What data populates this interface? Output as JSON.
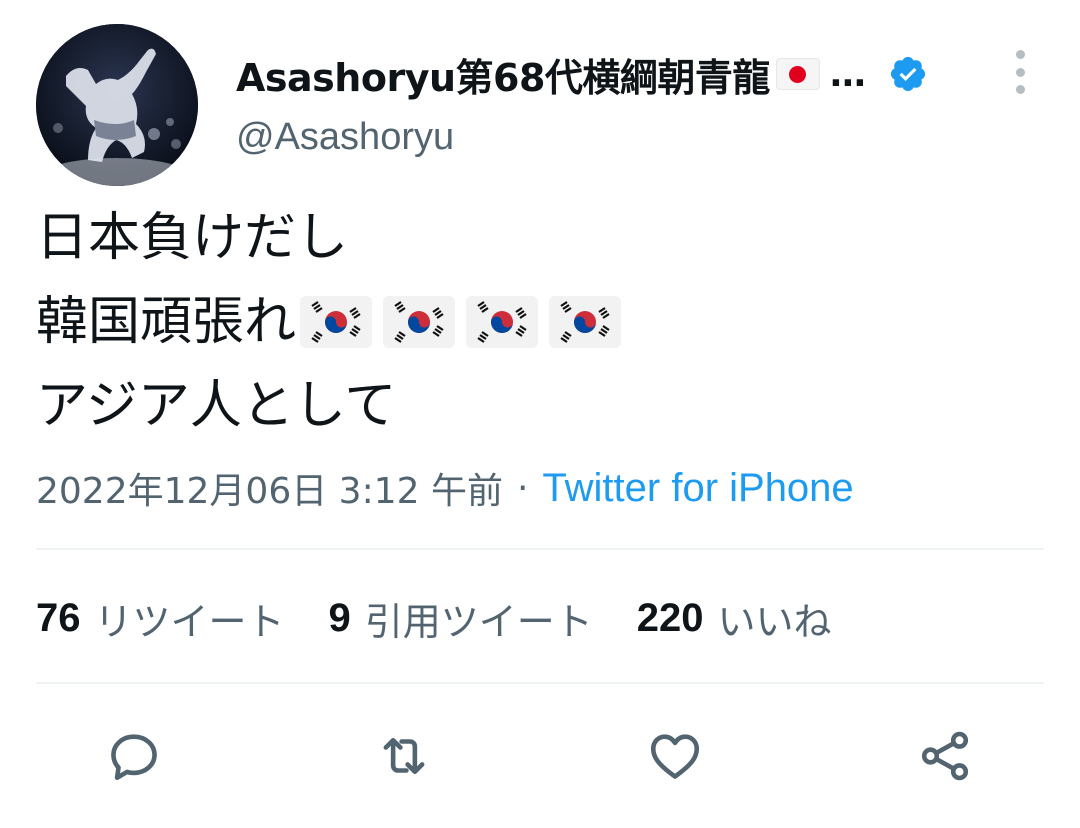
{
  "tweet": {
    "author": {
      "display_name": "Asashoryu第68代横綱朝青龍",
      "name_flag_icon": "flag-japan",
      "truncation": "…",
      "verified_icon": "verified-badge-icon",
      "handle": "@Asashoryu"
    },
    "text_lines": [
      "日本負けだし",
      "韓国頑張れ",
      "アジア人として"
    ],
    "line2_flags": [
      "flag-south-korea",
      "flag-south-korea",
      "flag-south-korea",
      "flag-south-korea"
    ],
    "timestamp": "2022年12月06日 3:12 午前",
    "separator": "·",
    "source": "Twitter for iPhone",
    "stats": {
      "retweets_count": "76",
      "retweets_label": "リツイート",
      "quotes_count": "9",
      "quotes_label": "引用ツイート",
      "likes_count": "220",
      "likes_label": "いいね"
    },
    "actions": [
      "reply-icon",
      "retweet-icon",
      "like-icon",
      "share-icon"
    ]
  },
  "colors": {
    "text_primary": "#0f1419",
    "text_secondary": "#536471",
    "link": "#1d9bf0",
    "divider": "#eff3f4",
    "icon": "#536471"
  }
}
